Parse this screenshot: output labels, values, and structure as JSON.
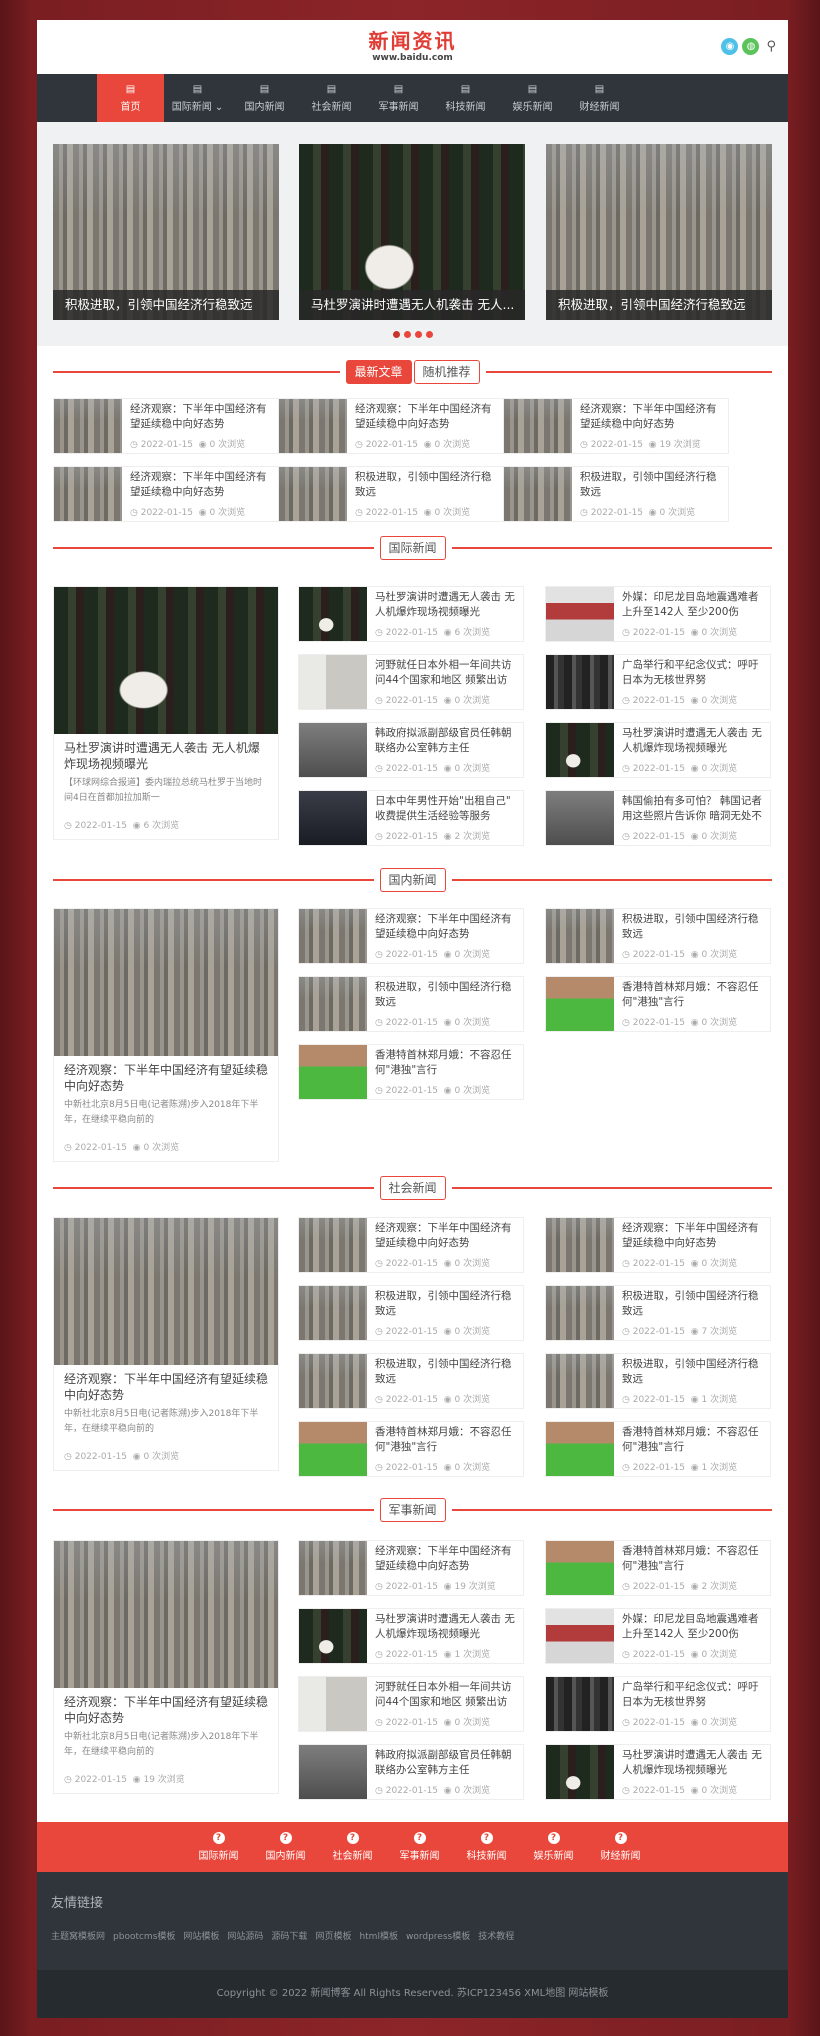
{
  "header": {
    "logo_title": "新闻资讯",
    "logo_url": "www.baidu.com"
  },
  "nav": [
    {
      "label": "首页",
      "active": true
    },
    {
      "label": "国际新闻 ⌄"
    },
    {
      "label": "国内新闻"
    },
    {
      "label": "社会新闻"
    },
    {
      "label": "军事新闻"
    },
    {
      "label": "科技新闻"
    },
    {
      "label": "娱乐新闻"
    },
    {
      "label": "财经新闻"
    }
  ],
  "slider": [
    {
      "caption": "积极进取，引领中国经济行稳致远"
    },
    {
      "caption": "马杜罗演讲时遭遇无人机袭击 无人..."
    },
    {
      "caption": "积极进取，引领中国经济行稳致远"
    }
  ],
  "latest": {
    "tabs": [
      "最新文章",
      "随机推荐"
    ],
    "items": [
      {
        "title": "经济观察：下半年中国经济有望延续稳中向好态势",
        "date": "2022-01-15",
        "views": "0 次浏览"
      },
      {
        "title": "经济观察：下半年中国经济有望延续稳中向好态势",
        "date": "2022-01-15",
        "views": "0 次浏览"
      },
      {
        "title": "经济观察：下半年中国经济有望延续稳中向好态势",
        "date": "2022-01-15",
        "views": "19 次浏览"
      },
      {
        "title": "经济观察：下半年中国经济有望延续稳中向好态势",
        "date": "2022-01-15",
        "views": "0 次浏览"
      },
      {
        "title": "积极进取，引领中国经济行稳致远",
        "date": "2022-01-15",
        "views": "0 次浏览"
      },
      {
        "title": "积极进取，引领中国经济行稳致远",
        "date": "2022-01-15",
        "views": "0 次浏览"
      }
    ]
  },
  "s_intl": {
    "title": "国际新闻",
    "big": {
      "title": "马杜罗演讲时遭遇无人袭击 无人机爆炸现场视频曝光",
      "desc": "【环球网综合报道】委内瑞拉总统马杜罗于当地时间4日在首都加拉加斯一",
      "date": "2022-01-15",
      "views": "6 次浏览"
    },
    "items": [
      {
        "title": "马杜罗演讲时遭遇无人袭击 无人机爆炸现场视频曝光",
        "date": "2022-01-15",
        "views": "6 次浏览"
      },
      {
        "title": "外媒：印尼龙目岛地震遇难者上升至142人 至少200伤",
        "date": "2022-01-15",
        "views": "0 次浏览"
      },
      {
        "title": "河野就任日本外相一年间共访问44个国家和地区 频繁出访被",
        "date": "2022-01-15",
        "views": "0 次浏览"
      },
      {
        "title": "广岛举行和平纪念仪式：呼吁日本为无核世界努",
        "date": "2022-01-15",
        "views": "0 次浏览"
      },
      {
        "title": "韩政府拟派副部级官员任韩朝联络办公室韩方主任",
        "date": "2022-01-15",
        "views": "0 次浏览"
      },
      {
        "title": "马杜罗演讲时遭遇无人袭击 无人机爆炸现场视频曝光",
        "date": "2022-01-15",
        "views": "0 次浏览"
      },
      {
        "title": "日本中年男性开始\"出租自己\" 收费提供生活经验等服务",
        "date": "2022-01-15",
        "views": "2 次浏览"
      },
      {
        "title": "韩国偷拍有多可怕？ 韩国记者用这些照片告诉你 暗洞无处不",
        "date": "2022-01-15",
        "views": "0 次浏览"
      }
    ]
  },
  "s_dom": {
    "title": "国内新闻",
    "big": {
      "title": "经济观察：下半年中国经济有望延续稳中向好态势",
      "desc": "中新社北京8月5日电(记者陈溯)步入2018年下半年，在继续平稳向前的",
      "date": "2022-01-15",
      "views": "0 次浏览"
    },
    "items": [
      {
        "title": "经济观察：下半年中国经济有望延续稳中向好态势",
        "date": "2022-01-15",
        "views": "0 次浏览"
      },
      {
        "title": "积极进取，引领中国经济行稳致远",
        "date": "2022-01-15",
        "views": "0 次浏览"
      },
      {
        "title": "积极进取，引领中国经济行稳致远",
        "date": "2022-01-15",
        "views": "0 次浏览"
      },
      {
        "title": "香港特首林郑月娥：不容忍任何\"港独\"言行",
        "date": "2022-01-15",
        "views": "0 次浏览"
      },
      {
        "title": "香港特首林郑月娥：不容忍任何\"港独\"言行",
        "date": "2022-01-15",
        "views": "0 次浏览"
      }
    ]
  },
  "s_soc": {
    "title": "社会新闻",
    "big": {
      "title": "经济观察：下半年中国经济有望延续稳中向好态势",
      "desc": "中新社北京8月5日电(记者陈溯)步入2018年下半年，在继续平稳向前的",
      "date": "2022-01-15",
      "views": "0 次浏览"
    },
    "items": [
      {
        "title": "经济观察：下半年中国经济有望延续稳中向好态势",
        "date": "2022-01-15",
        "views": "0 次浏览"
      },
      {
        "title": "经济观察：下半年中国经济有望延续稳中向好态势",
        "date": "2022-01-15",
        "views": "0 次浏览"
      },
      {
        "title": "积极进取，引领中国经济行稳致远",
        "date": "2022-01-15",
        "views": "0 次浏览"
      },
      {
        "title": "积极进取，引领中国经济行稳致远",
        "date": "2022-01-15",
        "views": "7 次浏览"
      },
      {
        "title": "积极进取，引领中国经济行稳致远",
        "date": "2022-01-15",
        "views": "0 次浏览"
      },
      {
        "title": "积极进取，引领中国经济行稳致远",
        "date": "2022-01-15",
        "views": "1 次浏览"
      },
      {
        "title": "香港特首林郑月娥：不容忍任何\"港独\"言行",
        "date": "2022-01-15",
        "views": "0 次浏览"
      },
      {
        "title": "香港特首林郑月娥：不容忍任何\"港独\"言行",
        "date": "2022-01-15",
        "views": "1 次浏览"
      }
    ]
  },
  "s_mil": {
    "title": "军事新闻",
    "big": {
      "title": "经济观察：下半年中国经济有望延续稳中向好态势",
      "desc": "中新社北京8月5日电(记者陈溯)步入2018年下半年，在继续平稳向前的",
      "date": "2022-01-15",
      "views": "19 次浏览"
    },
    "items": [
      {
        "title": "经济观察：下半年中国经济有望延续稳中向好态势",
        "date": "2022-01-15",
        "views": "19 次浏览"
      },
      {
        "title": "香港特首林郑月娥：不容忍任何\"港独\"言行",
        "date": "2022-01-15",
        "views": "2 次浏览"
      },
      {
        "title": "马杜罗演讲时遭遇无人袭击 无人机爆炸现场视频曝光",
        "date": "2022-01-15",
        "views": "1 次浏览"
      },
      {
        "title": "外媒：印尼龙目岛地震遇难者上升至142人 至少200伤",
        "date": "2022-01-15",
        "views": "0 次浏览"
      },
      {
        "title": "河野就任日本外相一年间共访问44个国家和地区 频繁出访被",
        "date": "2022-01-15",
        "views": "0 次浏览"
      },
      {
        "title": "广岛举行和平纪念仪式：呼吁日本为无核世界努",
        "date": "2022-01-15",
        "views": "0 次浏览"
      },
      {
        "title": "韩政府拟派副部级官员任韩朝联络办公室韩方主任",
        "date": "2022-01-15",
        "views": "0 次浏览"
      },
      {
        "title": "马杜罗演讲时遭遇无人袭击 无人机爆炸现场视频曝光",
        "date": "2022-01-15",
        "views": "0 次浏览"
      }
    ]
  },
  "footnav": [
    "国际新闻",
    "国内新闻",
    "社会新闻",
    "军事新闻",
    "科技新闻",
    "娱乐新闻",
    "财经新闻"
  ],
  "links": {
    "heading": "友情链接",
    "items": [
      "主题窝模板网",
      "pbootcms模板",
      "网站模板",
      "网站源码",
      "源码下载",
      "网页模板",
      "html模板",
      "wordpress模板",
      "技术教程"
    ]
  },
  "copyright": "Copyright © 2022 新闻博客 All Rights Reserved. 苏ICP123456 XML地图 网站模板",
  "colors": {
    "accent": "#e9473b",
    "nav_bg": "#2f353b"
  }
}
